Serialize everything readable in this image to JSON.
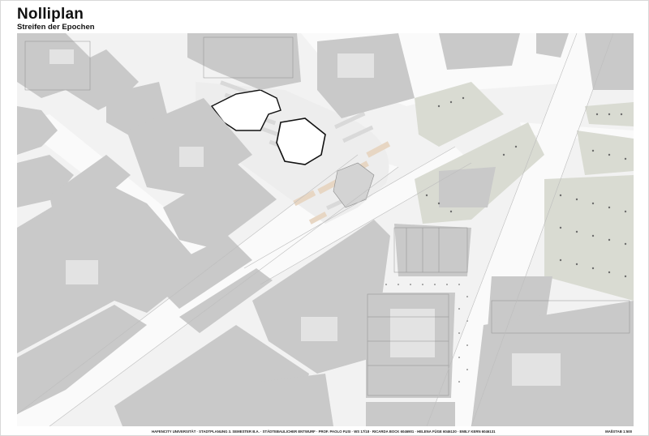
{
  "title": "Nolliplan",
  "subtitle": "Streifen der Epochen",
  "footer": {
    "credits": "HAFENCITY UNIVERSITÄT · STADTPLANUNG 3. SEMESTER B.A. · STÄDTEBAULICHER ENTWURF · PROF. PAOLO FUSI · WS 17/18 · RICARDA BOCK 6046901 · HELENA FÜGE 6046130 · EMILY KERN 6046131",
    "scale": "MAßSTAB 1:500"
  },
  "colors": {
    "building": "#c9c9c9",
    "ground": "#f2f2f2",
    "street": "#fafafa",
    "park": "#d9dbd2",
    "accent": "#e7d6c3",
    "outline": "#111111"
  }
}
